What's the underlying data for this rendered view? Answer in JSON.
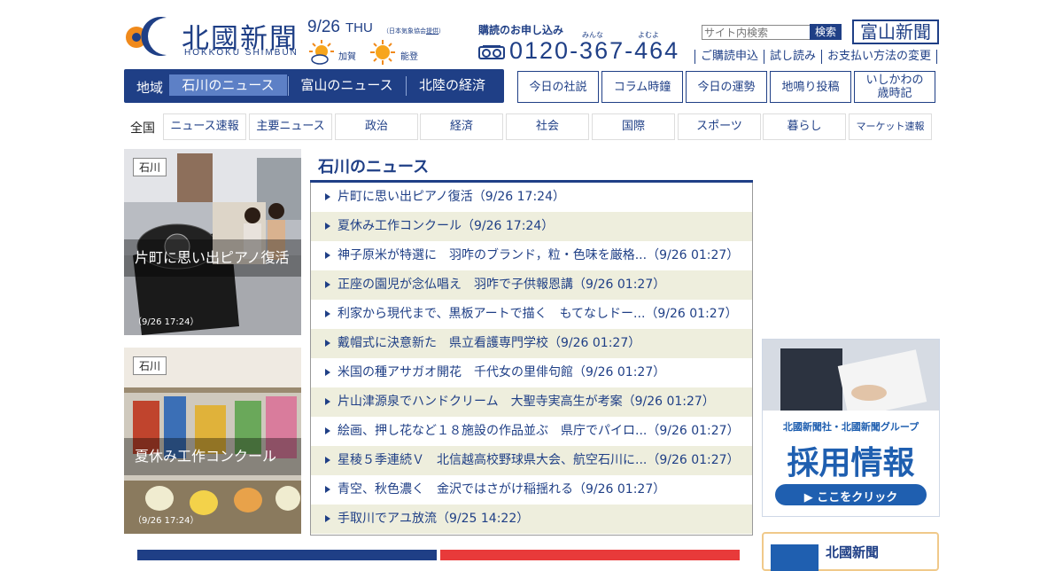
{
  "header": {
    "logo_kanji": "北國新聞",
    "logo_roman": "HOKKOKU SHIMBUN",
    "date": "9/26",
    "weekday": "THU",
    "weather_source_prefix": "（日本気象協会",
    "weather_source_link": "提供",
    "weather_source_suffix": "）",
    "weather": [
      {
        "area": "加賀",
        "icon": "sun-cloud-icon"
      },
      {
        "area": "能登",
        "icon": "sun-icon"
      }
    ],
    "subscription_title": "購読のお申し込み",
    "ruby": [
      "みんな",
      "よむよ"
    ],
    "phone": "0120-367-464",
    "search_placeholder": "サイト内検索",
    "search_button": "検索",
    "toyama_button": "富山新聞",
    "sub_links": [
      "ご購読申込",
      "試し読み",
      "お支払い方法の変更"
    ]
  },
  "region_nav": {
    "label": "地域",
    "tabs": [
      "石川のニュース",
      "富山のニュース",
      "北陸の経済"
    ],
    "active_index": 0
  },
  "feature_links": [
    "今日の社説",
    "コラム時鐘",
    "今日の運勢",
    "地鳴り投稿",
    "いしかわの\n歳時記"
  ],
  "categories": {
    "label": "全国",
    "items": [
      "ニュース速報",
      "主要ニュース",
      "政治",
      "経済",
      "社会",
      "国際",
      "スポーツ",
      "暮らし",
      "マーケット速報"
    ]
  },
  "photo_tiles": [
    {
      "tag": "石川",
      "caption": "片町に思い出ピアノ復活",
      "time": "（9/26 17:24）"
    },
    {
      "tag": "石川",
      "caption": "夏休み工作コンクール",
      "time": "（9/26 17:24）"
    }
  ],
  "news": {
    "title": "石川のニュース",
    "items": [
      "片町に思い出ピアノ復活（9/26 17:24）",
      "夏休み工作コンクール（9/26 17:24）",
      "神子原米が特選に　羽咋のブランド，粒・色味を厳格...（9/26 01:27）",
      "正座の園児が念仏唱え　羽咋で子供報恩講（9/26 01:27）",
      "利家から現代まで、黒板アートで描く　もてなしドー...（9/26 01:27）",
      "戴帽式に決意新た　県立看護専門学校（9/26 01:27）",
      "米国の種アサガオ開花　千代女の里俳句館（9/26 01:27）",
      "片山津源泉でハンドクリーム　大聖寺実高生が考案（9/26 01:27）",
      "絵画、押し花など１８施設の作品並ぶ　県庁でパイロ...（9/26 01:27）",
      "星稜５季連続Ｖ　北信越高校野球県大会、航空石川に...（9/26 01:27）",
      "青空、秋色濃く　金沢ではさがけ稲揺れる（9/26 01:27）",
      "手取川でアユ放流（9/25 14:22）"
    ]
  },
  "ad": {
    "line1": "北國新聞社・北國新聞グループ",
    "line2": "採用情報",
    "button": "▶ ここをクリック"
  },
  "ad2": {
    "title": "北國新聞"
  },
  "colors": {
    "brand": "#1f3f86",
    "active_tab": "#5d80c6",
    "alt_row": "#eeeedd",
    "ad_blue": "#1f5fb0"
  }
}
